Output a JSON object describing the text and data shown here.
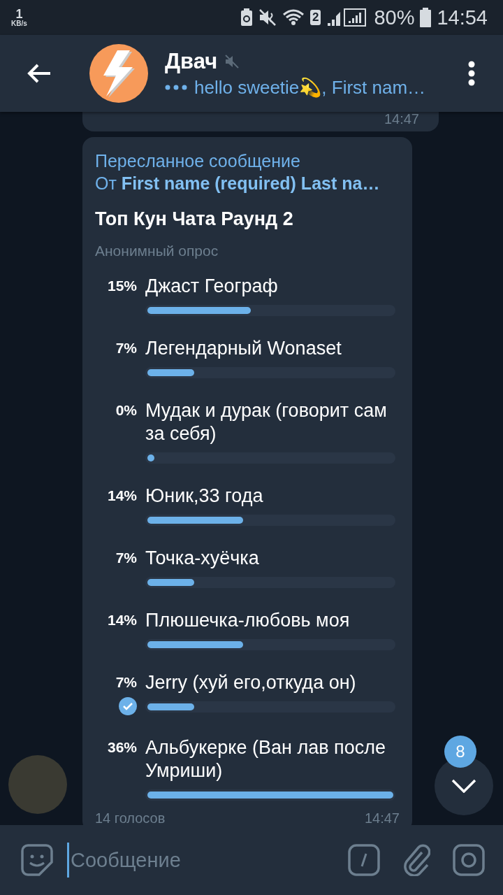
{
  "status_bar": {
    "speed_value": "1",
    "speed_unit": "KB/s",
    "sim_label": "2",
    "battery": "80%",
    "time": "14:54"
  },
  "header": {
    "title": "Двач",
    "muted": true,
    "subtitle": "hello sweetie💫, First nam…"
  },
  "previous_message": {
    "time": "14:47"
  },
  "poll": {
    "forwarded_label": "Пересланное сообщение",
    "from_prefix": "От",
    "from_name": "First name (required) Last na…",
    "question": "Топ Кун Чата Раунд 2",
    "type_label": "Анонимный опрос",
    "options": [
      {
        "percent": "15%",
        "text": "Джаст Географ",
        "level": 0.42,
        "chosen": false
      },
      {
        "percent": "7%",
        "text": "Легендарный Wonaset",
        "level": 0.19,
        "chosen": false
      },
      {
        "percent": "0%",
        "text": "Мудак и дурак (говорит сам за себя)",
        "level": 0.0,
        "chosen": false
      },
      {
        "percent": "14%",
        "text": "Юник,33 года",
        "level": 0.39,
        "chosen": false
      },
      {
        "percent": "7%",
        "text": "Точка-хуёчка",
        "level": 0.19,
        "chosen": false
      },
      {
        "percent": "14%",
        "text": "Плюшечка-любовь моя",
        "level": 0.39,
        "chosen": false
      },
      {
        "percent": "7%",
        "text": "Jerry (хуй его,откуда он)",
        "level": 0.19,
        "chosen": true
      },
      {
        "percent": "36%",
        "text": "Альбукерке (Ван лав после Умриши)",
        "level": 1.0,
        "chosen": false
      }
    ],
    "votes": "14 голосов",
    "time": "14:47"
  },
  "unread_badge": "8",
  "composer": {
    "placeholder": "Сообщение"
  }
}
